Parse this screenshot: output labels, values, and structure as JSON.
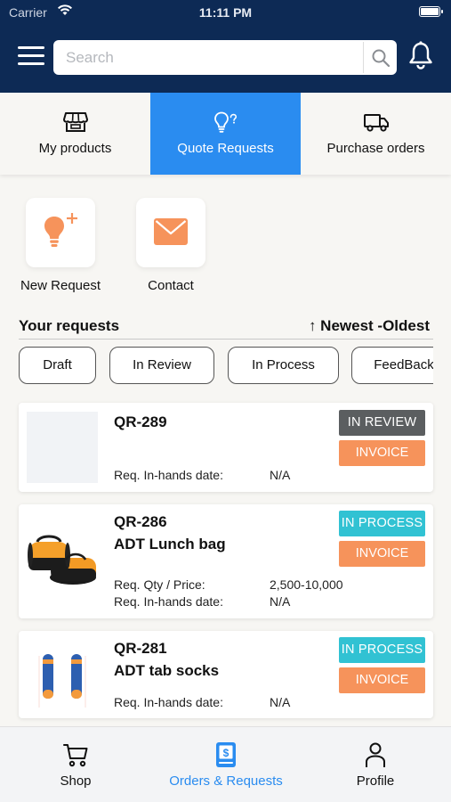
{
  "status_bar": {
    "carrier": "Carrier",
    "time": "11:11 PM"
  },
  "header": {
    "search_placeholder": "Search"
  },
  "tabs": [
    {
      "label": "My products",
      "icon": "store-icon",
      "active": false
    },
    {
      "label": "Quote Requests",
      "icon": "lightbulb-question-icon",
      "active": true
    },
    {
      "label": "Purchase orders",
      "icon": "truck-icon",
      "active": false
    }
  ],
  "actions": [
    {
      "label": "New Request",
      "icon": "lightbulb-plus-icon"
    },
    {
      "label": "Contact",
      "icon": "envelope-icon"
    }
  ],
  "requests": {
    "title": "Your requests",
    "sort_label": "↑  Newest -Oldest",
    "filters": [
      "Draft",
      "In Review",
      "In Process",
      "FeedBack"
    ],
    "cards": [
      {
        "id": "QR-289",
        "name": "",
        "status": "IN REVIEW",
        "invoice": "INVOICE",
        "qty_label": "",
        "qty_value": "",
        "date_label": "Req. In-hands date:",
        "date_value": "N/A"
      },
      {
        "id": "QR-286",
        "name": "ADT Lunch bag",
        "status": "IN PROCESS",
        "invoice": "INVOICE",
        "qty_label": "Req. Qty / Price:",
        "qty_value": "2,500-10,000",
        "date_label": "Req. In-hands date:",
        "date_value": "N/A"
      },
      {
        "id": "QR-281",
        "name": "ADT tab socks",
        "status": "IN PROCESS",
        "invoice": "INVOICE",
        "qty_label": "",
        "qty_value": "",
        "date_label": "Req. In-hands date:",
        "date_value": "N/A"
      }
    ]
  },
  "bottom_nav": [
    {
      "label": "Shop",
      "icon": "cart-icon",
      "active": false
    },
    {
      "label": "Orders & Requests",
      "icon": "dollar-document-icon",
      "active": true
    },
    {
      "label": "Profile",
      "icon": "person-icon",
      "active": false
    }
  ],
  "colors": {
    "header_bg": "#0d2a55",
    "accent_blue": "#2a8cf0",
    "in_review": "#5b5e60",
    "in_process": "#31c2d3",
    "invoice": "#f6935b",
    "action_icon": "#f6935b"
  }
}
